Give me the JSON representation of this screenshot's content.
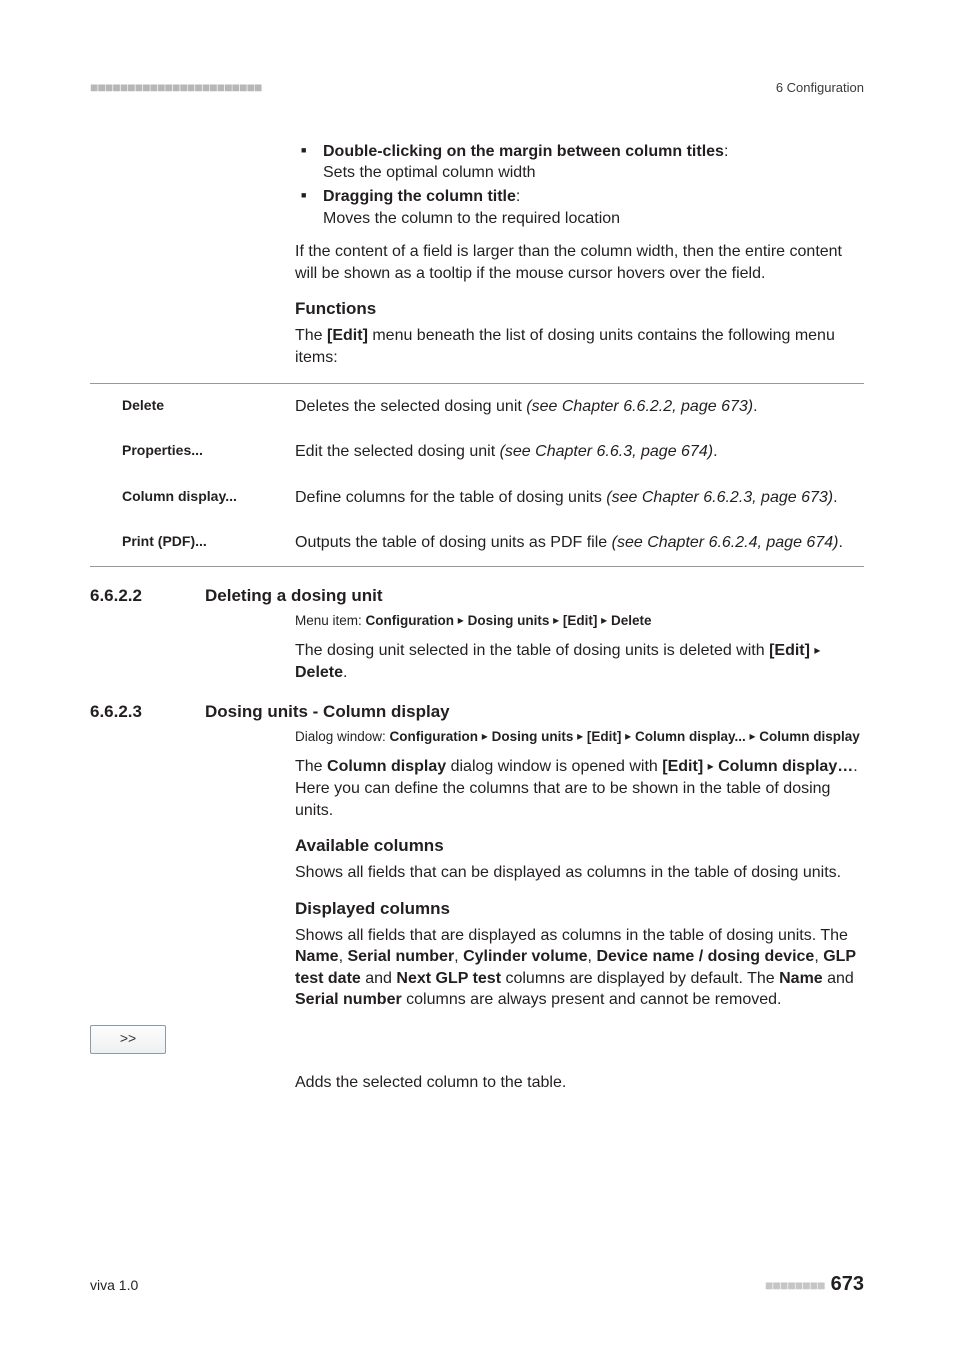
{
  "header": {
    "dashes": "■■■■■■■■■■■■■■■■■■■■■■■",
    "right": "6 Configuration"
  },
  "intro": {
    "bullets": [
      {
        "title": "Double-clicking on the margin between column titles",
        "desc": "Sets the optimal column width"
      },
      {
        "title": "Dragging the column title",
        "desc": "Moves the column to the required location"
      }
    ],
    "tooltip_para": "If the content of a field is larger than the column width, then the entire content will be shown as a tooltip if the mouse cursor hovers over the field."
  },
  "functions": {
    "heading": "Functions",
    "intro_pre": "The ",
    "intro_bold": "[Edit]",
    "intro_post": " menu beneath the list of dosing units contains the following menu items:",
    "rows": [
      {
        "term": "Delete",
        "desc_pre": "Deletes the selected dosing unit ",
        "desc_em": "(see Chapter 6.6.2.2, page 673)",
        "desc_post": "."
      },
      {
        "term": "Properties...",
        "desc_pre": "Edit the selected dosing unit ",
        "desc_em": "(see Chapter 6.6.3, page 674)",
        "desc_post": "."
      },
      {
        "term": "Column display...",
        "desc_pre": "Define columns for the table of dosing units ",
        "desc_em": "(see Chapter 6.6.2.3, page 673)",
        "desc_post": "."
      },
      {
        "term": "Print (PDF)...",
        "desc_pre": "Outputs the table of dosing units as PDF file ",
        "desc_em": "(see Chapter 6.6.2.4, page 674)",
        "desc_post": "."
      }
    ]
  },
  "sect_6622": {
    "num": "6.6.2.2",
    "title": "Deleting a dosing unit",
    "crumb_label": "Menu item: ",
    "crumb_parts": [
      "Configuration",
      "Dosing units",
      "[Edit]",
      "Delete"
    ],
    "para_pre": "The dosing unit selected in the table of dosing units is deleted with ",
    "para_bold1": "[Edit]",
    "para_mid": " ",
    "para_bold2": "Delete",
    "para_post": "."
  },
  "sect_6623": {
    "num": "6.6.2.3",
    "title": "Dosing units - Column display",
    "crumb_label": "Dialog window: ",
    "crumb_parts": [
      "Configuration",
      "Dosing units",
      "[Edit]",
      "Column display...",
      "Column display"
    ],
    "para1_pre": "The ",
    "para1_b1": "Column display",
    "para1_mid1": " dialog window is opened with ",
    "para1_b2": "[Edit]",
    "para1_mid2": " ",
    "para1_b3": "Column display…",
    "para1_post": ". Here you can define the columns that are to be shown in the table of dosing units.",
    "avail_head": "Available columns",
    "avail_para": "Shows all fields that can be displayed as columns in the table of dosing units.",
    "disp_head": "Displayed columns",
    "disp_para_pre": "Shows all fields that are displayed as columns in the table of dosing units. The ",
    "f1": "Name",
    "c": ", ",
    "f2": "Serial number",
    "f3": "Cylinder volume",
    "f4": "Device name / dosing device",
    "f5": "GLP test date",
    "and": " and ",
    "f6": "Next GLP test",
    "disp_para_mid": " columns are displayed by default. The ",
    "f7": "Name",
    "f8": "Serial number",
    "disp_para_post": " columns are always present and cannot be removed.",
    "btn_label": ">>",
    "btn_desc": "Adds the selected column to the table."
  },
  "footer": {
    "left": "viva 1.0",
    "dashes": "■■■■■■■■",
    "page": "673"
  },
  "glyphs": {
    "tri": "▸"
  }
}
